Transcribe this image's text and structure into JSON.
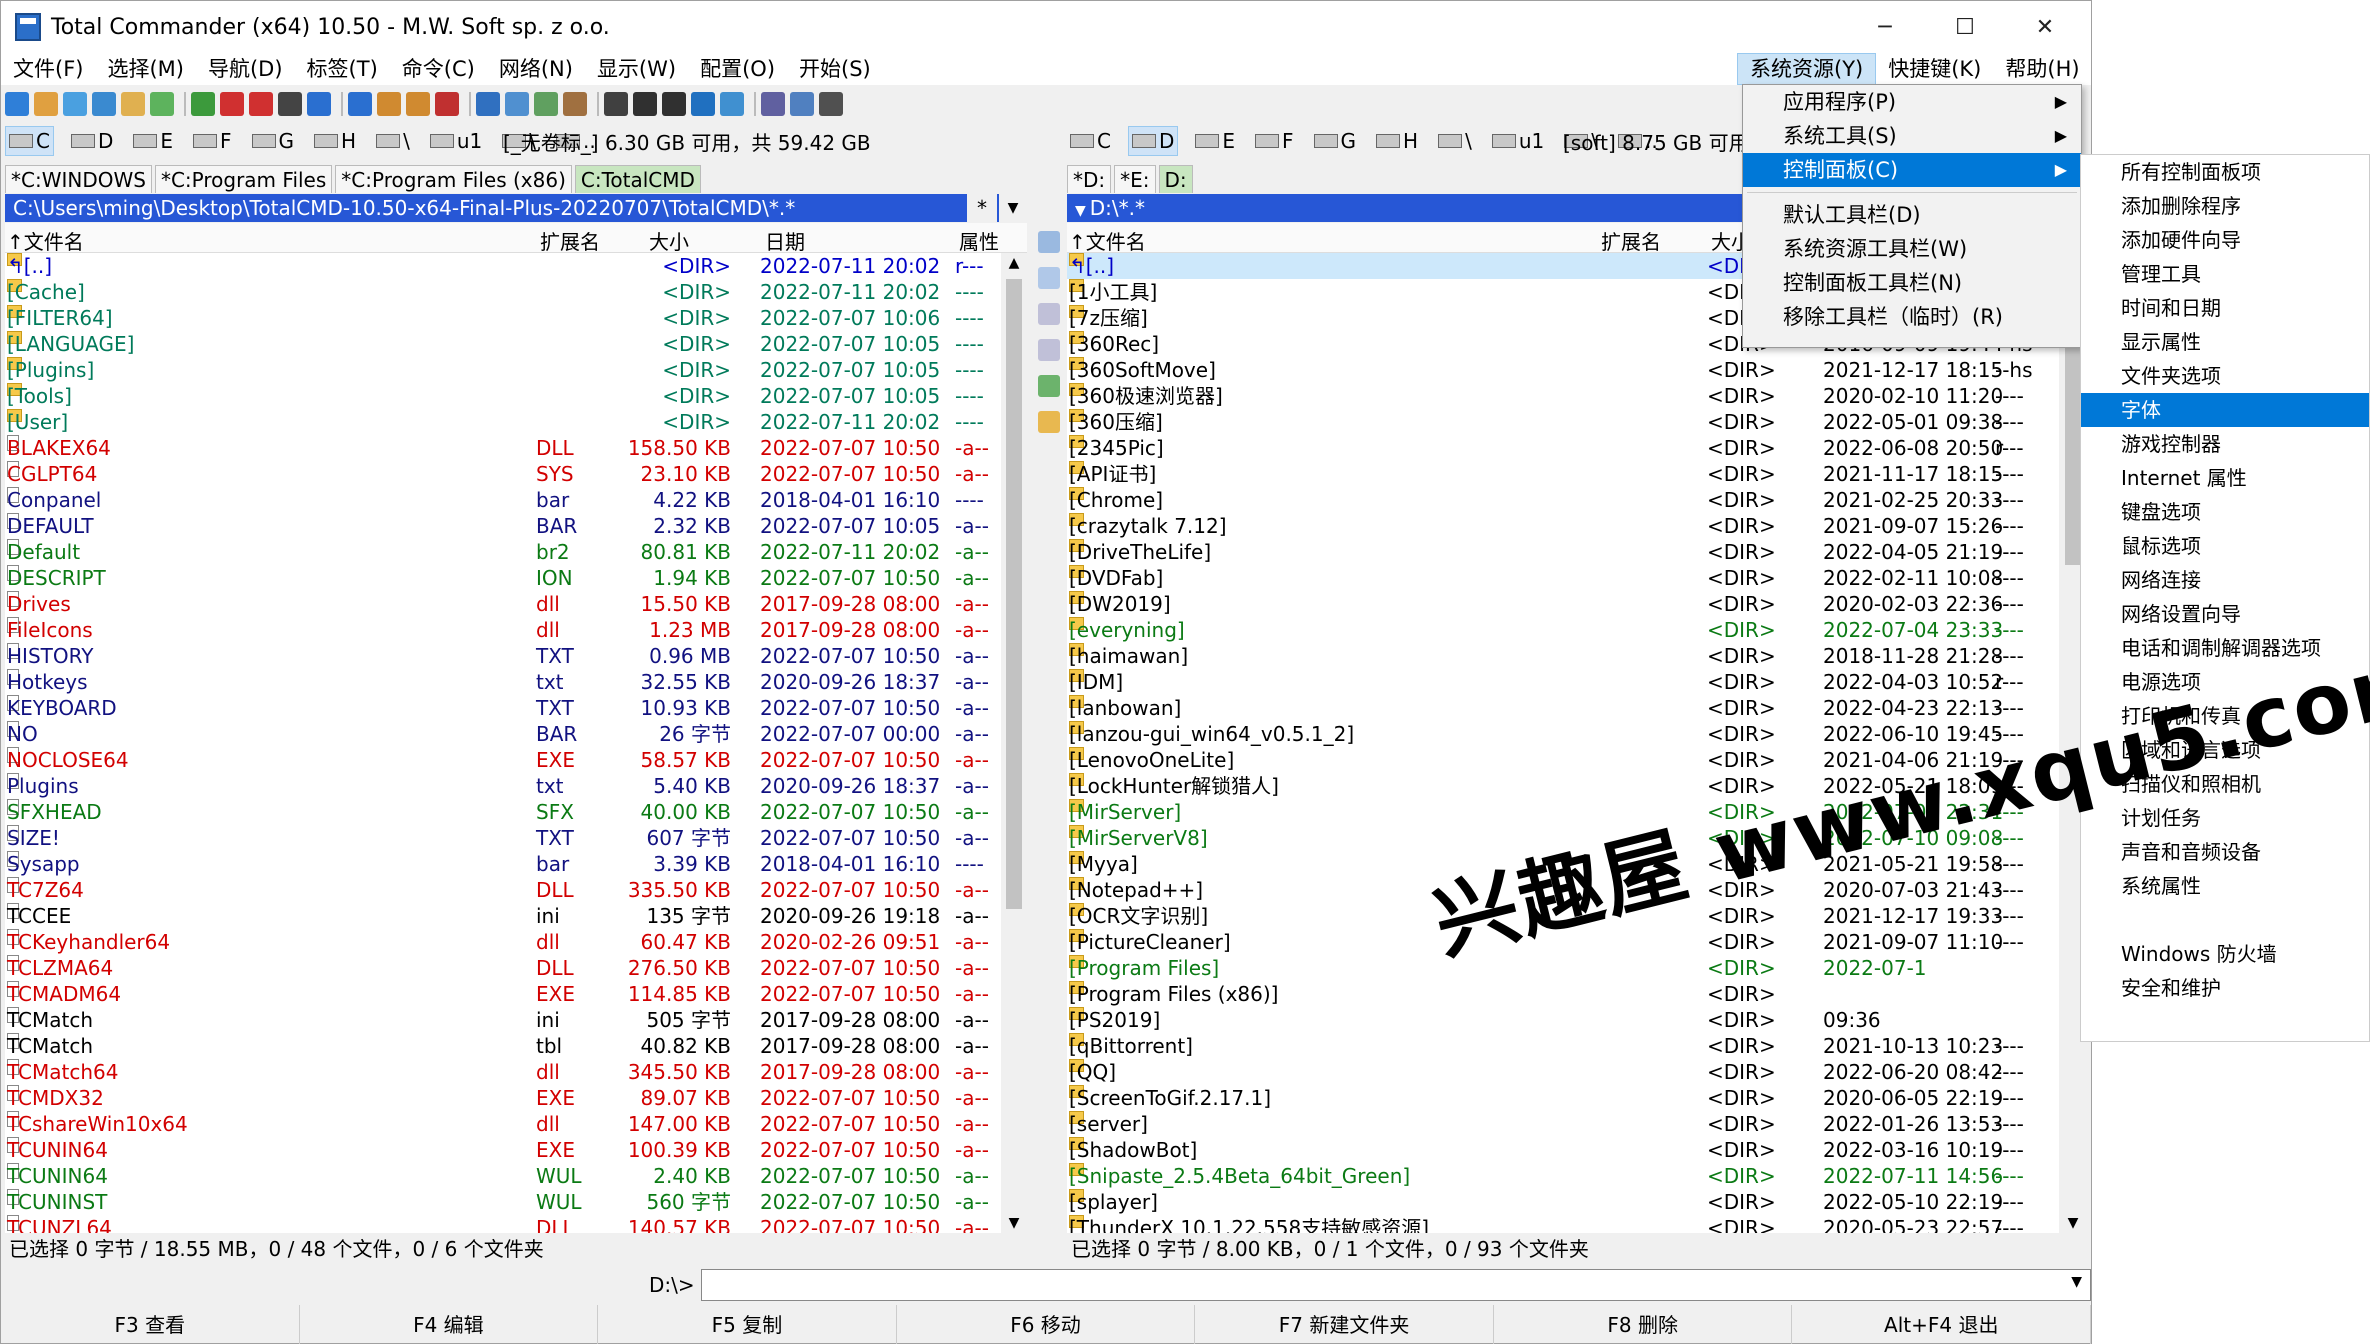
{
  "window": {
    "title": "Total Commander (x64) 10.50 - M.W. Soft sp. z o.o.",
    "minimize": "─",
    "maximize": "☐",
    "close": "✕"
  },
  "menubar": {
    "left": [
      "文件(F)",
      "选择(M)",
      "导航(D)",
      "标签(T)",
      "命令(C)",
      "网络(N)",
      "显示(W)",
      "配置(O)",
      "开始(S)"
    ],
    "right": [
      "系统资源(Y)",
      "快捷键(K)",
      "帮助(H)"
    ]
  },
  "left": {
    "drives": [
      "C",
      "D",
      "E",
      "F",
      "G",
      "H",
      "\\",
      "u1",
      "\\",
      ".."
    ],
    "volume": "[_无卷标_]  6.30 GB 可用，共 59.42 GB",
    "tabs": [
      "*C:WINDOWS",
      "*C:Program Files",
      "*C:Program Files (x86)",
      "C:TotalCMD"
    ],
    "path": "C:\\Users\\ming\\Desktop\\TotalCMD-10.50-x64-Final-Plus-20220707\\TotalCMD\\*.*",
    "path_btns": [
      "*",
      "▼"
    ],
    "headers": {
      "name": "↑文件名",
      "ext": "扩展名",
      "size": "大小",
      "date": "日期",
      "attr": "属性"
    },
    "files": [
      {
        "n": "↰[..]",
        "e": "",
        "s": "<DIR>",
        "d": "2022-07-11 20:02",
        "a": "r---",
        "c": "c-blu",
        "dir": true
      },
      {
        "n": "[Cache]",
        "e": "",
        "s": "<DIR>",
        "d": "2022-07-11 20:02",
        "a": "----",
        "c": "c-teal",
        "dir": true
      },
      {
        "n": "[FILTER64]",
        "e": "",
        "s": "<DIR>",
        "d": "2022-07-07 10:06",
        "a": "----",
        "c": "c-teal",
        "dir": true
      },
      {
        "n": "[LANGUAGE]",
        "e": "",
        "s": "<DIR>",
        "d": "2022-07-07 10:05",
        "a": "----",
        "c": "c-teal",
        "dir": true
      },
      {
        "n": "[Plugins]",
        "e": "",
        "s": "<DIR>",
        "d": "2022-07-07 10:05",
        "a": "----",
        "c": "c-teal",
        "dir": true
      },
      {
        "n": "[Tools]",
        "e": "",
        "s": "<DIR>",
        "d": "2022-07-07 10:05",
        "a": "----",
        "c": "c-teal",
        "dir": true
      },
      {
        "n": "[User]",
        "e": "",
        "s": "<DIR>",
        "d": "2022-07-11 20:02",
        "a": "----",
        "c": "c-teal",
        "dir": true
      },
      {
        "n": "BLAKEX64",
        "e": "DLL",
        "s": "158.50 KB",
        "d": "2022-07-07 10:50",
        "a": "-a--",
        "c": "c-red"
      },
      {
        "n": "CGLPT64",
        "e": "SYS",
        "s": "23.10 KB",
        "d": "2022-07-07 10:50",
        "a": "-a--",
        "c": "c-red"
      },
      {
        "n": "Conpanel",
        "e": "bar",
        "s": "4.22 KB",
        "d": "2018-04-01 16:10",
        "a": "----",
        "c": "c-navy"
      },
      {
        "n": "DEFAULT",
        "e": "BAR",
        "s": "2.32 KB",
        "d": "2022-07-07 10:05",
        "a": "-a--",
        "c": "c-navy"
      },
      {
        "n": "Default",
        "e": "br2",
        "s": "80.81 KB",
        "d": "2022-07-11 20:02",
        "a": "-a--",
        "c": "c-grn"
      },
      {
        "n": "DESCRIPT",
        "e": "ION",
        "s": "1.94 KB",
        "d": "2022-07-07 10:50",
        "a": "-a--",
        "c": "c-grn"
      },
      {
        "n": "Drives",
        "e": "dll",
        "s": "15.50 KB",
        "d": "2017-09-28 08:00",
        "a": "-a--",
        "c": "c-red"
      },
      {
        "n": "FileIcons",
        "e": "dll",
        "s": "1.23 MB",
        "d": "2017-09-28 08:00",
        "a": "-a--",
        "c": "c-red"
      },
      {
        "n": "HISTORY",
        "e": "TXT",
        "s": "0.96 MB",
        "d": "2022-07-07 10:50",
        "a": "-a--",
        "c": "c-navy"
      },
      {
        "n": "Hotkeys",
        "e": "txt",
        "s": "32.55 KB",
        "d": "2020-09-26 18:37",
        "a": "-a--",
        "c": "c-navy"
      },
      {
        "n": "KEYBOARD",
        "e": "TXT",
        "s": "10.93 KB",
        "d": "2022-07-07 10:50",
        "a": "-a--",
        "c": "c-navy"
      },
      {
        "n": "NO",
        "e": "BAR",
        "s": "26 字节",
        "d": "2022-07-07 00:00",
        "a": "-a--",
        "c": "c-navy"
      },
      {
        "n": "NOCLOSE64",
        "e": "EXE",
        "s": "58.57 KB",
        "d": "2022-07-07 10:50",
        "a": "-a--",
        "c": "c-red"
      },
      {
        "n": "Plugins",
        "e": "txt",
        "s": "5.40 KB",
        "d": "2020-09-26 18:37",
        "a": "-a--",
        "c": "c-navy"
      },
      {
        "n": "SFXHEAD",
        "e": "SFX",
        "s": "40.00 KB",
        "d": "2022-07-07 10:50",
        "a": "-a--",
        "c": "c-grn"
      },
      {
        "n": "SIZE!",
        "e": "TXT",
        "s": "607 字节",
        "d": "2022-07-07 10:50",
        "a": "-a--",
        "c": "c-navy"
      },
      {
        "n": "Sysapp",
        "e": "bar",
        "s": "3.39 KB",
        "d": "2018-04-01 16:10",
        "a": "----",
        "c": "c-navy"
      },
      {
        "n": "TC7Z64",
        "e": "DLL",
        "s": "335.50 KB",
        "d": "2022-07-07 10:50",
        "a": "-a--",
        "c": "c-red"
      },
      {
        "n": "TCCEE",
        "e": "ini",
        "s": "135 字节",
        "d": "2020-09-26 19:18",
        "a": "-a--",
        "c": "c-blk"
      },
      {
        "n": "TCKeyhandler64",
        "e": "dll",
        "s": "60.47 KB",
        "d": "2020-02-26 09:51",
        "a": "-a--",
        "c": "c-red"
      },
      {
        "n": "TCLZMA64",
        "e": "DLL",
        "s": "276.50 KB",
        "d": "2022-07-07 10:50",
        "a": "-a--",
        "c": "c-red"
      },
      {
        "n": "TCMADM64",
        "e": "EXE",
        "s": "114.85 KB",
        "d": "2022-07-07 10:50",
        "a": "-a--",
        "c": "c-red"
      },
      {
        "n": "TCMatch",
        "e": "ini",
        "s": "505 字节",
        "d": "2017-09-28 08:00",
        "a": "-a--",
        "c": "c-blk"
      },
      {
        "n": "TCMatch",
        "e": "tbl",
        "s": "40.82 KB",
        "d": "2017-09-28 08:00",
        "a": "-a--",
        "c": "c-blk"
      },
      {
        "n": "TCMatch64",
        "e": "dll",
        "s": "345.50 KB",
        "d": "2017-09-28 08:00",
        "a": "-a--",
        "c": "c-red"
      },
      {
        "n": "TCMDX32",
        "e": "EXE",
        "s": "89.07 KB",
        "d": "2022-07-07 10:50",
        "a": "-a--",
        "c": "c-red"
      },
      {
        "n": "TCshareWin10x64",
        "e": "dll",
        "s": "147.00 KB",
        "d": "2022-07-07 10:50",
        "a": "-a--",
        "c": "c-red"
      },
      {
        "n": "TCUNIN64",
        "e": "EXE",
        "s": "100.39 KB",
        "d": "2022-07-07 10:50",
        "a": "-a--",
        "c": "c-red"
      },
      {
        "n": "TCUNIN64",
        "e": "WUL",
        "s": "2.40 KB",
        "d": "2022-07-07 10:50",
        "a": "-a--",
        "c": "c-grn"
      },
      {
        "n": "TCUNINST",
        "e": "WUL",
        "s": "560 字节",
        "d": "2022-07-07 10:50",
        "a": "-a--",
        "c": "c-grn"
      },
      {
        "n": "TCUNZL64",
        "e": "DLL",
        "s": "140.57 KB",
        "d": "2022-07-07 10:50",
        "a": "-a--",
        "c": "c-red"
      }
    ],
    "status": "已选择 0 字节 / 18.55 MB，0 / 48 个文件，0 / 6 个文件夹"
  },
  "right": {
    "drives": [
      "C",
      "D",
      "E",
      "F",
      "G",
      "H",
      "\\",
      "u1",
      "\\",
      ".."
    ],
    "volume": "[soft]  8.75 GB 可用",
    "tabs": [
      "*D:",
      "*E:",
      "D:"
    ],
    "path": "D:\\*.*",
    "headers": {
      "name": "↑文件名",
      "ext": "扩展名",
      "size": "大小"
    },
    "files": [
      {
        "n": "↰[..]",
        "s": "<DI",
        "d": "",
        "a": "",
        "c": "c-blu"
      },
      {
        "n": "[1小工具]",
        "s": "<DI",
        "d": "",
        "a": "",
        "c": "c-blk"
      },
      {
        "n": "[7z压缩]",
        "s": "<DI",
        "d": "",
        "a": "",
        "c": "c-blk"
      },
      {
        "n": "[360Rec]",
        "s": "<DIR>",
        "d": "2016-09-09 19:44",
        "a": "--hs",
        "c": "c-blk"
      },
      {
        "n": "[360SoftMove]",
        "s": "<DIR>",
        "d": "2021-12-17 18:15",
        "a": "--hs",
        "c": "c-blk"
      },
      {
        "n": "[360极速浏览器]",
        "s": "<DIR>",
        "d": "2020-02-10 11:20",
        "a": "----",
        "c": "c-blk"
      },
      {
        "n": "[360压缩]",
        "s": "<DIR>",
        "d": "2022-05-01 09:38",
        "a": "----",
        "c": "c-blk"
      },
      {
        "n": "[2345Pic]",
        "s": "<DIR>",
        "d": "2022-06-08 20:50",
        "a": "r---",
        "c": "c-blk"
      },
      {
        "n": "[API证书]",
        "s": "<DIR>",
        "d": "2021-11-17 18:15",
        "a": "----",
        "c": "c-blk"
      },
      {
        "n": "[Chrome]",
        "s": "<DIR>",
        "d": "2021-02-25 20:33",
        "a": "----",
        "c": "c-blk"
      },
      {
        "n": "[crazytalk 7.12]",
        "s": "<DIR>",
        "d": "2021-09-07 15:26",
        "a": "----",
        "c": "c-blk"
      },
      {
        "n": "[DriveTheLife]",
        "s": "<DIR>",
        "d": "2022-04-05 21:19",
        "a": "----",
        "c": "c-blk"
      },
      {
        "n": "[DVDFab]",
        "s": "<DIR>",
        "d": "2022-02-11 10:08",
        "a": "----",
        "c": "c-blk"
      },
      {
        "n": "[DW2019]",
        "s": "<DIR>",
        "d": "2020-02-03 22:36",
        "a": "----",
        "c": "c-blk"
      },
      {
        "n": "[everyning]",
        "s": "<DIR>",
        "d": "2022-07-04 23:33",
        "a": "----",
        "c": "c-grn"
      },
      {
        "n": "[haimawan]",
        "s": "<DIR>",
        "d": "2018-11-28 21:28",
        "a": "----",
        "c": "c-blk"
      },
      {
        "n": "[IDM]",
        "s": "<DIR>",
        "d": "2022-04-03 10:52",
        "a": "r---",
        "c": "c-blk"
      },
      {
        "n": "[lanbowan]",
        "s": "<DIR>",
        "d": "2022-04-23 22:13",
        "a": "----",
        "c": "c-blk"
      },
      {
        "n": "[lanzou-gui_win64_v0.5.1_2]",
        "s": "<DIR>",
        "d": "2022-06-10 19:45",
        "a": "----",
        "c": "c-blk"
      },
      {
        "n": "[LenovoOneLite]",
        "s": "<DIR>",
        "d": "2021-04-06 21:19",
        "a": "----",
        "c": "c-blk"
      },
      {
        "n": "[LockHunter解锁猎人]",
        "s": "<DIR>",
        "d": "2022-05-21 18:09",
        "a": "----",
        "c": "c-blk"
      },
      {
        "n": "[MirServer]",
        "s": "<DIR>",
        "d": "2022-07-05 22:31",
        "a": "----",
        "c": "c-grn"
      },
      {
        "n": "[MirServerV8]",
        "s": "<DIR>",
        "d": "2022-07-10 09:08",
        "a": "----",
        "c": "c-grn"
      },
      {
        "n": "[Myya]",
        "s": "<DIR>",
        "d": "2021-05-21 19:58",
        "a": "----",
        "c": "c-blk"
      },
      {
        "n": "[Notepad++]",
        "s": "<DIR>",
        "d": "2020-07-03 21:43",
        "a": "----",
        "c": "c-blk"
      },
      {
        "n": "[OCR文字识别]",
        "s": "<DIR>",
        "d": "2021-12-17 19:33",
        "a": "----",
        "c": "c-blk"
      },
      {
        "n": "[PictureCleaner]",
        "s": "<DIR>",
        "d": "2021-09-07 11:10",
        "a": "----",
        "c": "c-blk"
      },
      {
        "n": "[Program Files]",
        "s": "<DIR>",
        "d": "2022-07-1",
        "a": "",
        "c": "c-grn"
      },
      {
        "n": "[Program Files (x86)]",
        "s": "<DIR>",
        "d": "",
        "a": "",
        "c": "c-blk"
      },
      {
        "n": "[PS2019]",
        "s": "<DIR>",
        "d": "  09:36",
        "a": "",
        "c": "c-blk"
      },
      {
        "n": "[qBittorrent]",
        "s": "<DIR>",
        "d": "2021-10-13 10:23",
        "a": "----",
        "c": "c-blk"
      },
      {
        "n": "[QQ]",
        "s": "<DIR>",
        "d": "2022-06-20 08:42",
        "a": "----",
        "c": "c-blk"
      },
      {
        "n": "[ScreenToGif.2.17.1]",
        "s": "<DIR>",
        "d": "2020-06-05 22:19",
        "a": "----",
        "c": "c-blk"
      },
      {
        "n": "[server]",
        "s": "<DIR>",
        "d": "2022-01-26 13:53",
        "a": "----",
        "c": "c-blk"
      },
      {
        "n": "[ShadowBot]",
        "s": "<DIR>",
        "d": "2022-03-16 10:19",
        "a": "----",
        "c": "c-blk"
      },
      {
        "n": "[Snipaste_2.5.4Beta_64bit_Green]",
        "s": "<DIR>",
        "d": "2022-07-11 14:56",
        "a": "----",
        "c": "c-grn"
      },
      {
        "n": "[splayer]",
        "s": "<DIR>",
        "d": "2022-05-10 22:19",
        "a": "----",
        "c": "c-blk"
      },
      {
        "n": "[ThunderX 10.1.22.558支持敏感资源]",
        "s": "<DIR>",
        "d": "2020-05-23 22:57",
        "a": "----",
        "c": "c-blk"
      }
    ],
    "status": "已选择 0 字节 / 8.00 KB，0 / 1 个文件，0 / 93 个文件夹"
  },
  "cmd": {
    "label": "D:\\>"
  },
  "fkeys": [
    "F3 查看",
    "F4 编辑",
    "F5 复制",
    "F6 移动",
    "F7 新建文件夹",
    "F8 删除",
    "Alt+F4 退出"
  ],
  "dropdown": {
    "items": [
      {
        "label": "应用程序(P)",
        "arrow": "▶"
      },
      {
        "label": "系统工具(S)",
        "arrow": "▶"
      },
      {
        "label": "控制面板(C)",
        "arrow": "▶",
        "hl": true
      },
      {
        "sep": true
      },
      {
        "label": "默认工具栏(D)"
      },
      {
        "label": "系统资源工具栏(W)"
      },
      {
        "label": "控制面板工具栏(N)"
      },
      {
        "label": "移除工具栏（临时）(R)"
      }
    ]
  },
  "submenu": {
    "items": [
      "所有控制面板项",
      "添加删除程序",
      "添加硬件向导",
      "管理工具",
      "时间和日期",
      "显示属性",
      "文件夹选项",
      "字体",
      "游戏控制器",
      "Internet 属性",
      "键盘选项",
      "鼠标选项",
      "网络连接",
      "网络设置向导",
      "电话和调制解调器选项",
      "电源选项",
      "打印机和传真",
      "区域和语言选项",
      "扫描仪和照相机",
      "计划任务",
      "声音和音频设备",
      "系统属性",
      "",
      "Windows 防火墙",
      "安全和维护"
    ],
    "highlight": 7
  },
  "watermark": "兴趣屋 www.xqu5.com",
  "colors": {
    "active_path": "#2757d6",
    "menu_highlight": "#0078d7",
    "active_tab": "#c8e6c0"
  }
}
